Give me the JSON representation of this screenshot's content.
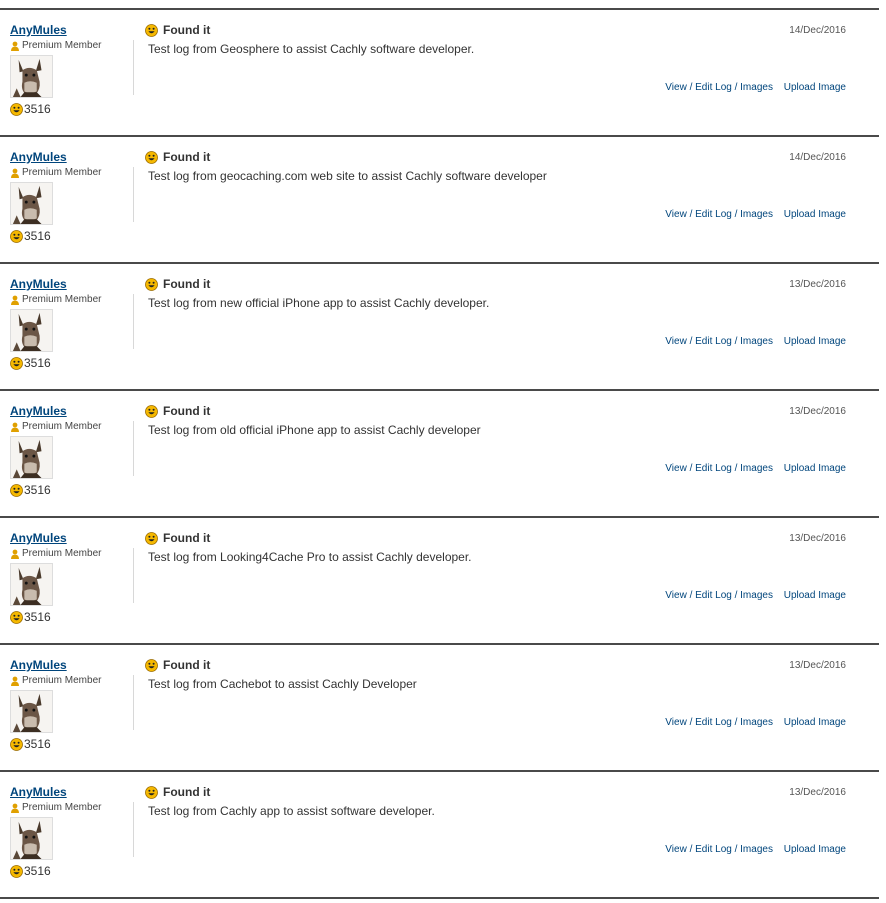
{
  "logs": [
    {
      "username": "AnyMules",
      "member_label": "Premium Member",
      "finds": "3516",
      "log_type": "Found it",
      "date": "14/Dec/2016",
      "text": "Test log from Geosphere to assist Cachly software developer.",
      "view_edit": "View / Edit Log / Images",
      "upload": "Upload Image"
    },
    {
      "username": "AnyMules",
      "member_label": "Premium Member",
      "finds": "3516",
      "log_type": "Found it",
      "date": "14/Dec/2016",
      "text": "Test log from geocaching.com web site to assist Cachly software developer",
      "view_edit": "View / Edit Log / Images",
      "upload": "Upload Image"
    },
    {
      "username": "AnyMules",
      "member_label": "Premium Member",
      "finds": "3516",
      "log_type": "Found it",
      "date": "13/Dec/2016",
      "text": "Test log from new official iPhone app to assist Cachly developer.",
      "view_edit": "View / Edit Log / Images",
      "upload": "Upload Image"
    },
    {
      "username": "AnyMules",
      "member_label": "Premium Member",
      "finds": "3516",
      "log_type": "Found it",
      "date": "13/Dec/2016",
      "text": "Test log from old official iPhone app to assist Cachly developer",
      "view_edit": "View / Edit Log / Images",
      "upload": "Upload Image"
    },
    {
      "username": "AnyMules",
      "member_label": "Premium Member",
      "finds": "3516",
      "log_type": "Found it",
      "date": "13/Dec/2016",
      "text": "Test log from Looking4Cache Pro to assist Cachly developer.",
      "view_edit": "View / Edit Log / Images",
      "upload": "Upload Image"
    },
    {
      "username": "AnyMules",
      "member_label": "Premium Member",
      "finds": "3516",
      "log_type": "Found it",
      "date": "13/Dec/2016",
      "text": "Test log from Cachebot to assist Cachly Developer",
      "view_edit": "View / Edit Log / Images",
      "upload": "Upload Image"
    },
    {
      "username": "AnyMules",
      "member_label": "Premium Member",
      "finds": "3516",
      "log_type": "Found it",
      "date": "13/Dec/2016",
      "text": "Test log from Cachly app to assist software developer.",
      "view_edit": "View / Edit Log / Images",
      "upload": "Upload Image"
    }
  ],
  "icons": {
    "member": "premium-member-icon",
    "found": "smiley-icon",
    "avatar": "donkey-avatar"
  },
  "colors": {
    "link": "#00457c",
    "divider": "#4a4a4a",
    "smiley": "#f5b800",
    "member_icon": "#e0a000"
  }
}
